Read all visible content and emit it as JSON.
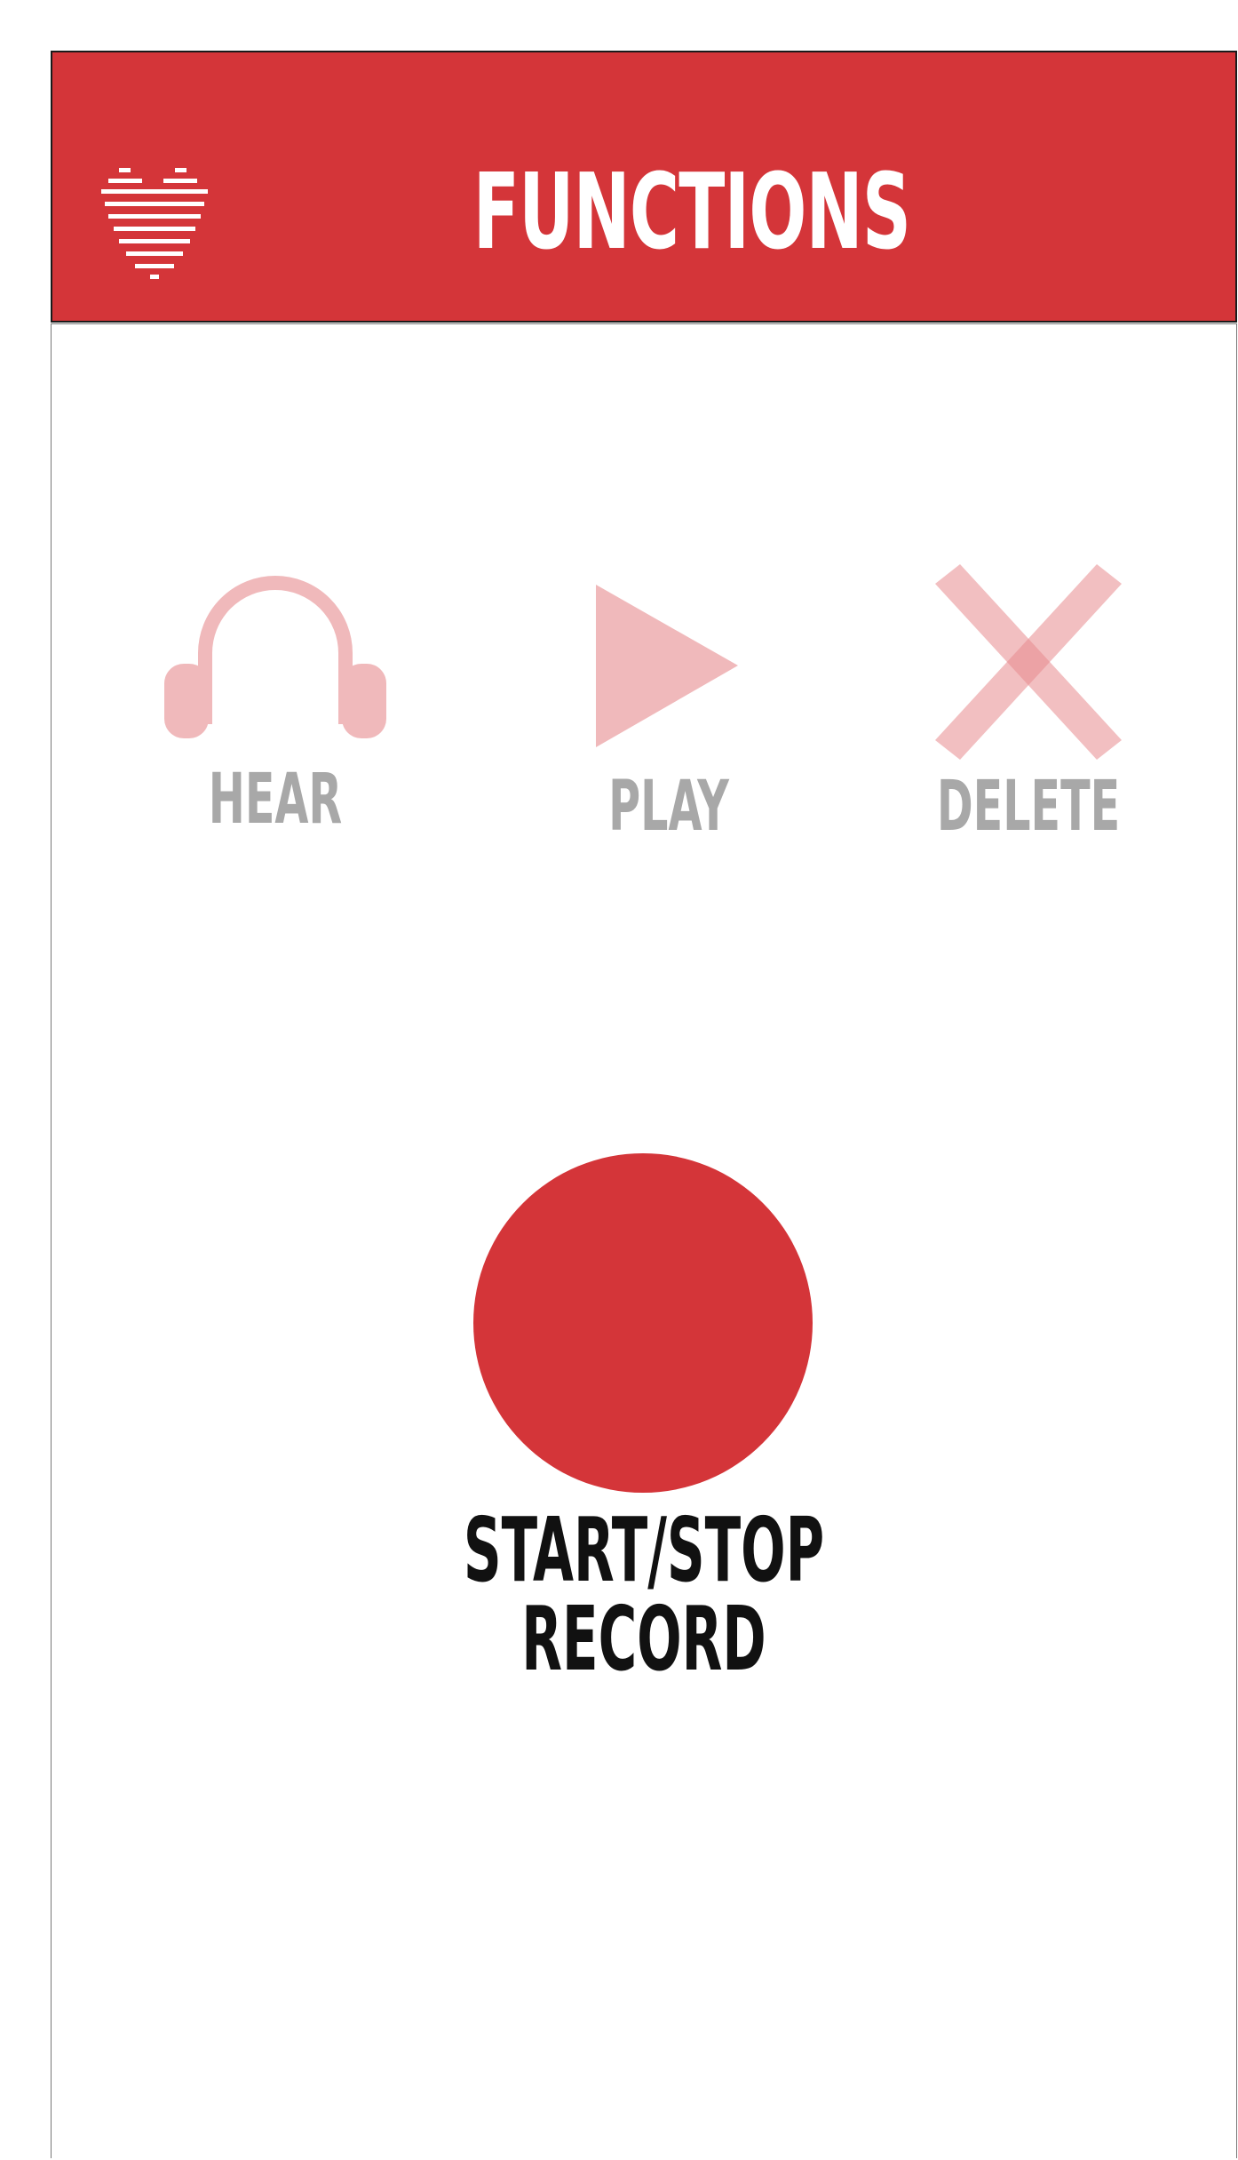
{
  "header": {
    "title": "FUNCTIONS",
    "logo_icon": "heart-lines-icon"
  },
  "functions": [
    {
      "label": "HEAR",
      "icon": "headphones-icon"
    },
    {
      "label": "PLAY",
      "icon": "play-icon"
    },
    {
      "label": "DELETE",
      "icon": "close-icon"
    }
  ],
  "record": {
    "label": "START/STOP RECORD"
  },
  "colors": {
    "brand_red": "#d43539",
    "icon_faded": "#f0b9bb",
    "label_gray": "#a8a8a8"
  }
}
